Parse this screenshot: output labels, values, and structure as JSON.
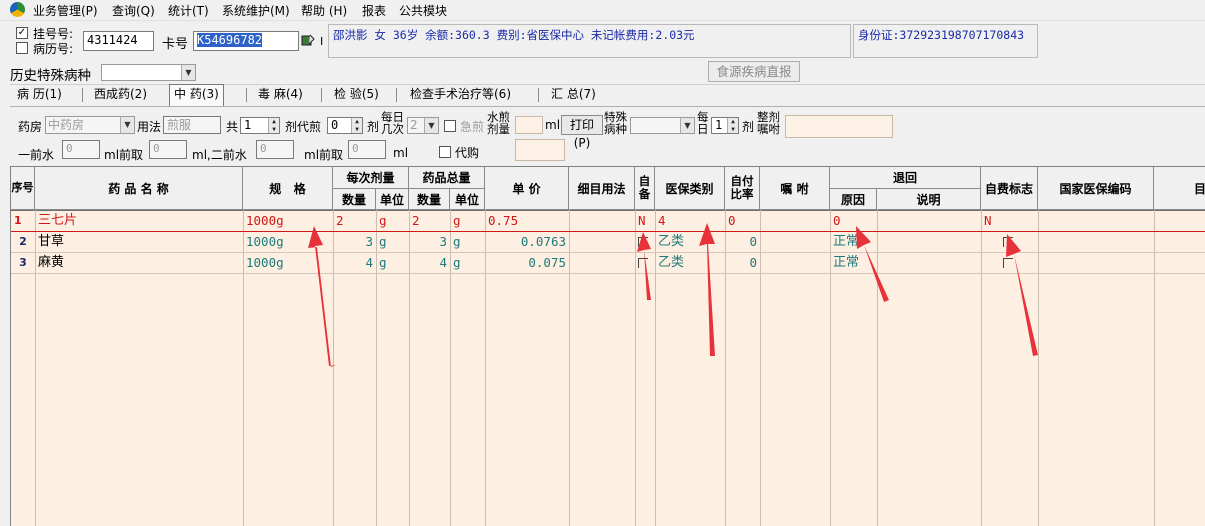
{
  "menu": {
    "items": [
      "业务管理(P)",
      "查询(Q)",
      "统计(T)",
      "系统维护(M)",
      "帮助 (H)",
      "报表",
      "公共模块"
    ]
  },
  "patient": {
    "reg_label": "挂号号:",
    "reg_checked": "✓",
    "record_label": "病历号:",
    "reg_number": "4311424",
    "card_label": "卡号",
    "card_number": "K54696782",
    "card_suffix": "I",
    "info": "邵洪影 女 36岁 余额:360.3 费别:省医保中心 未记帐费用:2.03元",
    "id_info": "身份证:372923198707170843"
  },
  "history": {
    "label": "历史特殊病种",
    "button": "食源疾病直报"
  },
  "tabs": [
    {
      "label": "病 历(1)"
    },
    {
      "label": "西成药(2)"
    },
    {
      "label": "中 药(3)"
    },
    {
      "label": "毒 麻(4)"
    },
    {
      "label": "检 验(5)"
    },
    {
      "label": "检查手术治疗等(6)"
    },
    {
      "label": "汇 总(7)"
    }
  ],
  "params": {
    "pharmacy_label": "药房",
    "pharmacy_value": "中药房",
    "usage_label": "用法",
    "usage_value": "煎服",
    "total_label": "共",
    "total_value": "1",
    "dose_unit": "剂代煎",
    "decoct_value": "0",
    "dose_unit2": "剂",
    "daily_label": "每日几次",
    "daily_value": "2",
    "urgent_label": "急煎",
    "water_before_label": "水煎剂量",
    "ml_label": "ml",
    "print_button": "打印(P)",
    "special_label": "特殊病种",
    "per_day_label": "每日",
    "per_day_value": "1",
    "dose_unit3": "剂",
    "advice_label": "整剂嘱咐",
    "first_water_label": "一前水",
    "first_water_value": "0",
    "ml_take_label": "ml前取",
    "first_take_value": "0",
    "second_water_label": "ml,二前水",
    "second_water_value": "0",
    "ml_take_label2": "ml前取",
    "second_take_value": "0",
    "ml_end": "ml",
    "proxy_label": "代购"
  },
  "table": {
    "headers": {
      "seq": "序号",
      "name": "药 品 名 称",
      "spec": "规   格",
      "dose_group": "每次剂量",
      "qty": "数量",
      "unit": "单位",
      "total_group": "药品总量",
      "qty2": "数量",
      "unit2": "单位",
      "price": "单 价",
      "usage": "细目用法",
      "self": "自备",
      "insurance": "医保类别",
      "ratio": "自付比率",
      "advice": "嘱 咐",
      "return_group": "退回",
      "reason": "原因",
      "note": "说明",
      "selfpay": "自费标志",
      "code": "国家医保编码",
      "extra": "目"
    },
    "rows": [
      {
        "seq": "1",
        "name": "三七片",
        "spec": "1000g",
        "qty": "2",
        "unit": "g",
        "qty2": "2",
        "unit2": "g",
        "price": "0.75",
        "self": "N",
        "insurance": "4",
        "ratio": "0",
        "reason": "0",
        "selfpay": "N"
      },
      {
        "seq": "2",
        "name": "甘草",
        "spec": "1000g",
        "qty": "3",
        "unit": "g",
        "qty2": "3",
        "unit2": "g",
        "price": "0.0763",
        "self": "",
        "insurance": "乙类",
        "ratio": "0",
        "reason": "正常",
        "selfpay": ""
      },
      {
        "seq": "3",
        "name": "麻黄",
        "spec": "1000g",
        "qty": "4",
        "unit": "g",
        "qty2": "4",
        "unit2": "g",
        "price": "0.075",
        "self": "",
        "insurance": "乙类",
        "ratio": "0",
        "reason": "正常",
        "selfpay": ""
      }
    ]
  },
  "colors": {
    "grid_bg": "#fdefe2",
    "row1_text": "#d01818",
    "row_text": "#1d7a7a",
    "info_text": "#1a2aa8",
    "arrow": "#e8323a"
  }
}
